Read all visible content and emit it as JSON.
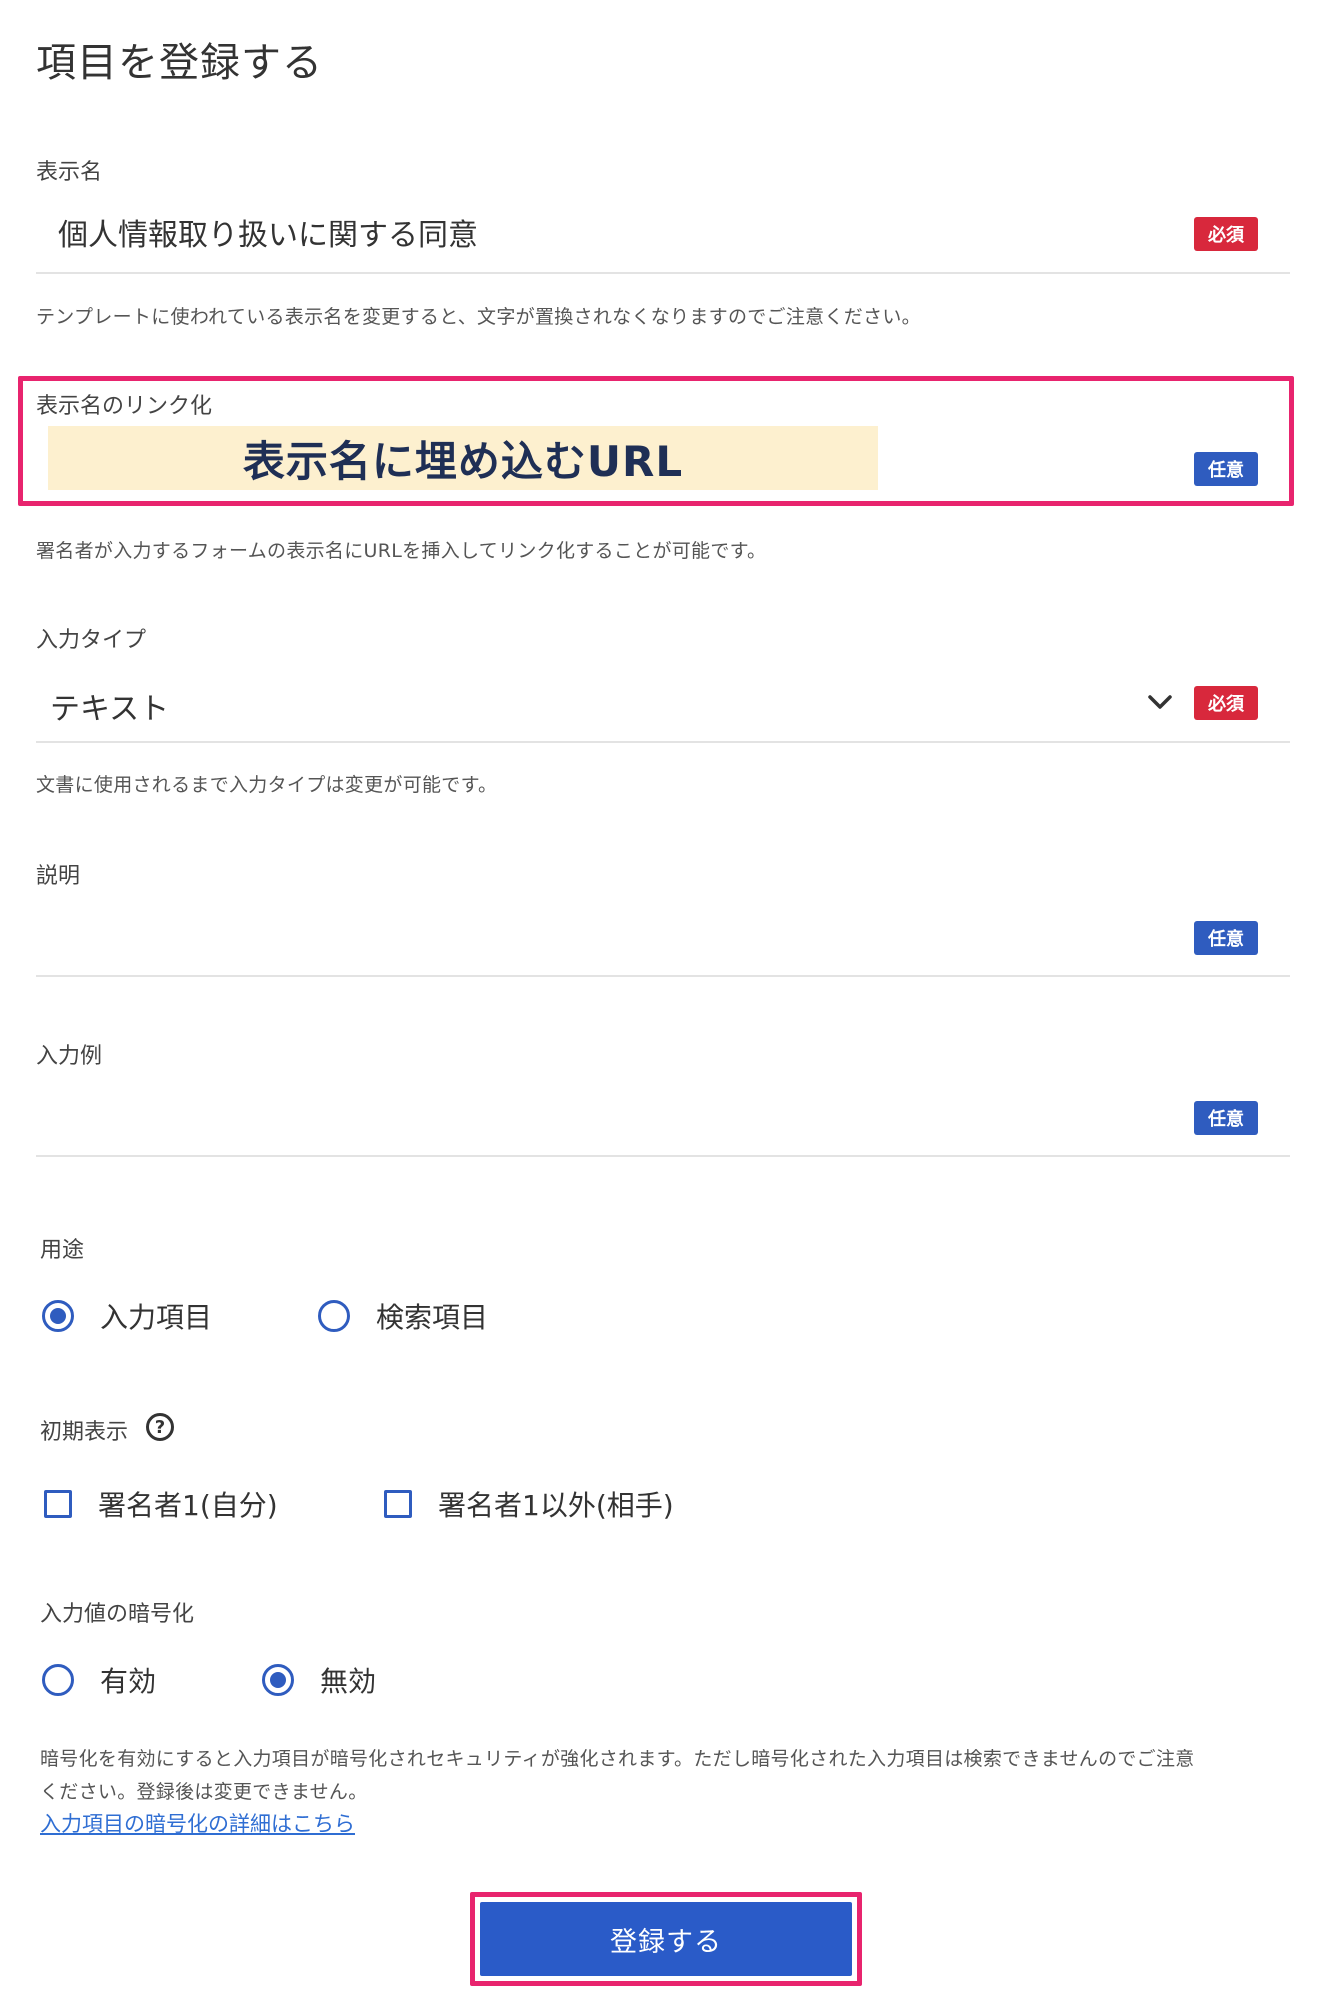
{
  "page": {
    "title": "項目を登録する"
  },
  "badges": {
    "required": "必須",
    "optional": "任意"
  },
  "display_name": {
    "label": "表示名",
    "value": "個人情報取り扱いに関する同意",
    "help": "テンプレートに使われている表示名を変更すると、文字が置換されなくなりますのでご注意ください。"
  },
  "link": {
    "label": "表示名のリンク化",
    "overlay": "表示名に埋め込むURL",
    "help": "署名者が入力するフォームの表示名にURLを挿入してリンク化することが可能です。"
  },
  "input_type": {
    "label": "入力タイプ",
    "value": "テキスト",
    "icon": "chevron-down-icon",
    "help": "文書に使用されるまで入力タイプは変更が可能です。"
  },
  "description": {
    "label": "説明",
    "value": ""
  },
  "example": {
    "label": "入力例",
    "value": ""
  },
  "usage": {
    "label": "用途",
    "options": [
      {
        "label": "入力項目",
        "selected": true
      },
      {
        "label": "検索項目",
        "selected": false
      }
    ]
  },
  "initial_display": {
    "label": "初期表示",
    "help_icon": "?",
    "options": [
      {
        "label": "署名者1(自分)",
        "checked": false
      },
      {
        "label": "署名者1以外(相手)",
        "checked": false
      }
    ]
  },
  "encryption": {
    "label": "入力値の暗号化",
    "options": [
      {
        "label": "有効",
        "selected": false
      },
      {
        "label": "無効",
        "selected": true
      }
    ],
    "help_line1": "暗号化を有効にすると入力項目が暗号化されセキュリティが強化されます。ただし暗号化された入力項目は検索できませんのでご注意",
    "help_line2": "ください。登録後は変更できません。",
    "link_text": "入力項目の暗号化の詳細はこちら"
  },
  "submit": {
    "label": "登録する"
  },
  "colors": {
    "accent": "#2f5cbf",
    "required": "#d8283c",
    "highlight": "#e8246e",
    "overlay_bg": "#fdf0cf",
    "button": "#2a5bc8"
  }
}
